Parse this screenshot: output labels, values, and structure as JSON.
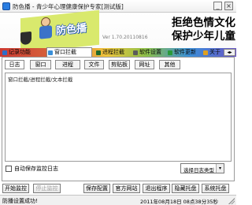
{
  "window": {
    "title": "防色播 - 青少年心理健康保护专家[测试版]",
    "minimize_glyph": "_",
    "close_glyph": "×"
  },
  "banner": {
    "logo_text": "防色播",
    "version": "Ver 1.70.20110816",
    "slogan_line1": "拒绝色情文化",
    "slogan_line2": "保护少年儿童"
  },
  "main_tabs": [
    {
      "label": "记录功能",
      "active": false
    },
    {
      "label": "窗口拦截",
      "active": true
    },
    {
      "label": "进程拦截",
      "active": false
    },
    {
      "label": "软件设置",
      "active": false
    },
    {
      "label": "软件更新",
      "active": false
    },
    {
      "label": "关于",
      "active": false
    }
  ],
  "tab_scroll_glyph": "◂▸",
  "sub_tabs": [
    "日志",
    "窗口",
    "进程",
    "文件",
    "剪贴板",
    "网址",
    "其他"
  ],
  "log_header": "窗口拦截/进程拦截/文本拦截",
  "auto_save_checkbox": {
    "label": "自动保存监控日志",
    "checked": false
  },
  "log_type_select": {
    "value": "选择日志类型"
  },
  "buttons": {
    "start": "开始监控",
    "stop": "停止监控",
    "save": "保存配置",
    "site": "官方网站",
    "exit": "退出程序",
    "hide": "隐藏托盘",
    "tray": "系统托盘"
  },
  "status": {
    "message": "防播设置成功!",
    "datetime": "2011年08月18日  08点38分35秒"
  },
  "colors": {
    "logo_bg": "#d9e96d",
    "tab_red": "#cc3a33",
    "tab_yellow": "#f0c63c",
    "tab_green": "#8bbf49",
    "tab_blue": "#3a8fd8",
    "tab_purple": "#6a55c6"
  },
  "icons": [
    "app-icon",
    "log-icon",
    "window-icon",
    "process-icon",
    "settings-icon",
    "update-icon",
    "about-icon",
    "dropdown-arrow-icon"
  ]
}
